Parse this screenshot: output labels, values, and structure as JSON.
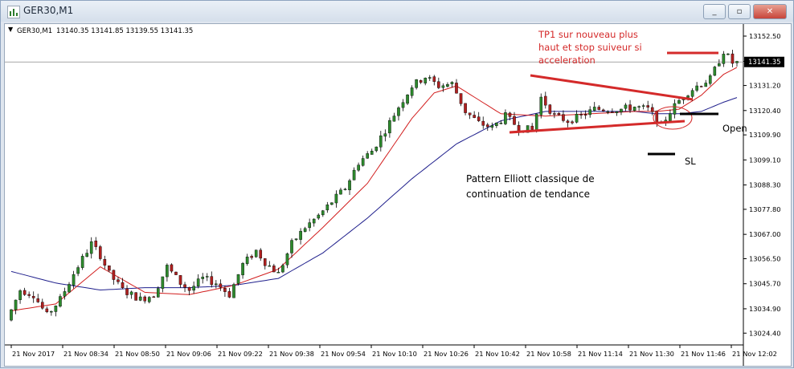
{
  "window": {
    "title": "GER30,M1",
    "buttons": {
      "minimize": "_",
      "restore": "▫",
      "close": "✕"
    }
  },
  "header": {
    "symbol": "GER30,M1",
    "ohlc": "13140.35 13141.85 13139.55 13141.35"
  },
  "price_tag": "13141.35",
  "annotations": {
    "tp1": [
      "TP1 sur nouveau plus",
      "haut et stop suiveur si",
      "acceleration"
    ],
    "open_label": "Open",
    "sl_label": "SL",
    "pattern": [
      "Pattern Elliott classique de",
      "continuation de tendance"
    ]
  },
  "colors": {
    "bull": "#2d8a2d",
    "bear": "#b02020",
    "ma_fast": "#d21e1e",
    "ma_slow": "#1f1f8c",
    "annotation_red": "#d42a2a",
    "annotation_black": "#000000"
  },
  "chart_data": {
    "type": "candlestick",
    "symbol": "GER30",
    "timeframe": "M1",
    "ylim": [
      13020.0,
      13157.0
    ],
    "y_ticks": [
      "13152.50",
      "13141.60",
      "13131.20",
      "13120.40",
      "13109.90",
      "13099.10",
      "13088.30",
      "13077.80",
      "13067.00",
      "13056.50",
      "13045.70",
      "13034.90",
      "13024.40"
    ],
    "x_ticks": [
      "21 Nov 2017",
      "21 Nov 08:34",
      "21 Nov 08:50",
      "21 Nov 09:06",
      "21 Nov 09:22",
      "21 Nov 09:38",
      "21 Nov 09:54",
      "21 Nov 10:10",
      "21 Nov 10:26",
      "21 Nov 10:42",
      "21 Nov 10:58",
      "21 Nov 11:14",
      "21 Nov 11:30",
      "21 Nov 11:46",
      "21 Nov 12:02"
    ],
    "price_path": [
      [
        0,
        13030
      ],
      [
        3,
        13043
      ],
      [
        6,
        13041
      ],
      [
        9,
        13032
      ],
      [
        12,
        13039
      ],
      [
        15,
        13050
      ],
      [
        19,
        13063
      ],
      [
        21,
        13058
      ],
      [
        23,
        13050
      ],
      [
        26,
        13043
      ],
      [
        30,
        13039
      ],
      [
        33,
        13041
      ],
      [
        36,
        13053
      ],
      [
        39,
        13046
      ],
      [
        41,
        13043
      ],
      [
        44,
        13048
      ],
      [
        47,
        13046
      ],
      [
        50,
        13041
      ],
      [
        53,
        13054
      ],
      [
        56,
        13060
      ],
      [
        58,
        13055
      ],
      [
        61,
        13050
      ],
      [
        64,
        13063
      ],
      [
        67,
        13070
      ],
      [
        70,
        13075
      ],
      [
        73,
        13081
      ],
      [
        76,
        13087
      ],
      [
        79,
        13098
      ],
      [
        82,
        13103
      ],
      [
        85,
        13112
      ],
      [
        88,
        13122
      ],
      [
        91,
        13131
      ],
      [
        94,
        13135
      ],
      [
        97,
        13131
      ],
      [
        100,
        13132
      ],
      [
        103,
        13120
      ],
      [
        106,
        13115
      ],
      [
        109,
        13113
      ],
      [
        112,
        13118
      ],
      [
        115,
        13113
      ],
      [
        118,
        13112
      ],
      [
        120,
        13126
      ],
      [
        123,
        13118
      ],
      [
        126,
        13116
      ],
      [
        129,
        13118
      ],
      [
        132,
        13121
      ],
      [
        135,
        13121
      ],
      [
        138,
        13121
      ],
      [
        141,
        13122
      ],
      [
        144,
        13121
      ],
      [
        147,
        13114
      ],
      [
        149,
        13120
      ],
      [
        152,
        13127
      ],
      [
        155,
        13131
      ],
      [
        158,
        13134
      ],
      [
        161,
        13146
      ],
      [
        163,
        13141
      ]
    ],
    "ma_fast": [
      [
        0,
        13034
      ],
      [
        10,
        13037
      ],
      [
        20,
        13053
      ],
      [
        30,
        13042
      ],
      [
        40,
        13041
      ],
      [
        50,
        13045
      ],
      [
        60,
        13052
      ],
      [
        70,
        13070
      ],
      [
        80,
        13089
      ],
      [
        90,
        13117
      ],
      [
        95,
        13128
      ],
      [
        100,
        13131
      ],
      [
        105,
        13125
      ],
      [
        110,
        13119
      ],
      [
        120,
        13118
      ],
      [
        130,
        13119
      ],
      [
        140,
        13120
      ],
      [
        145,
        13120
      ],
      [
        150,
        13121
      ],
      [
        155,
        13127
      ],
      [
        160,
        13136
      ],
      [
        163,
        13139
      ]
    ],
    "ma_slow": [
      [
        0,
        13051
      ],
      [
        10,
        13046
      ],
      [
        20,
        13043
      ],
      [
        30,
        13044
      ],
      [
        40,
        13044
      ],
      [
        50,
        13045
      ],
      [
        60,
        13048
      ],
      [
        70,
        13059
      ],
      [
        80,
        13074
      ],
      [
        90,
        13091
      ],
      [
        100,
        13106
      ],
      [
        110,
        13116
      ],
      [
        120,
        13120
      ],
      [
        130,
        13120
      ],
      [
        140,
        13120
      ],
      [
        145,
        13119
      ],
      [
        150,
        13119
      ],
      [
        155,
        13120
      ],
      [
        160,
        13124
      ],
      [
        163,
        13126
      ]
    ],
    "bars": 164
  }
}
